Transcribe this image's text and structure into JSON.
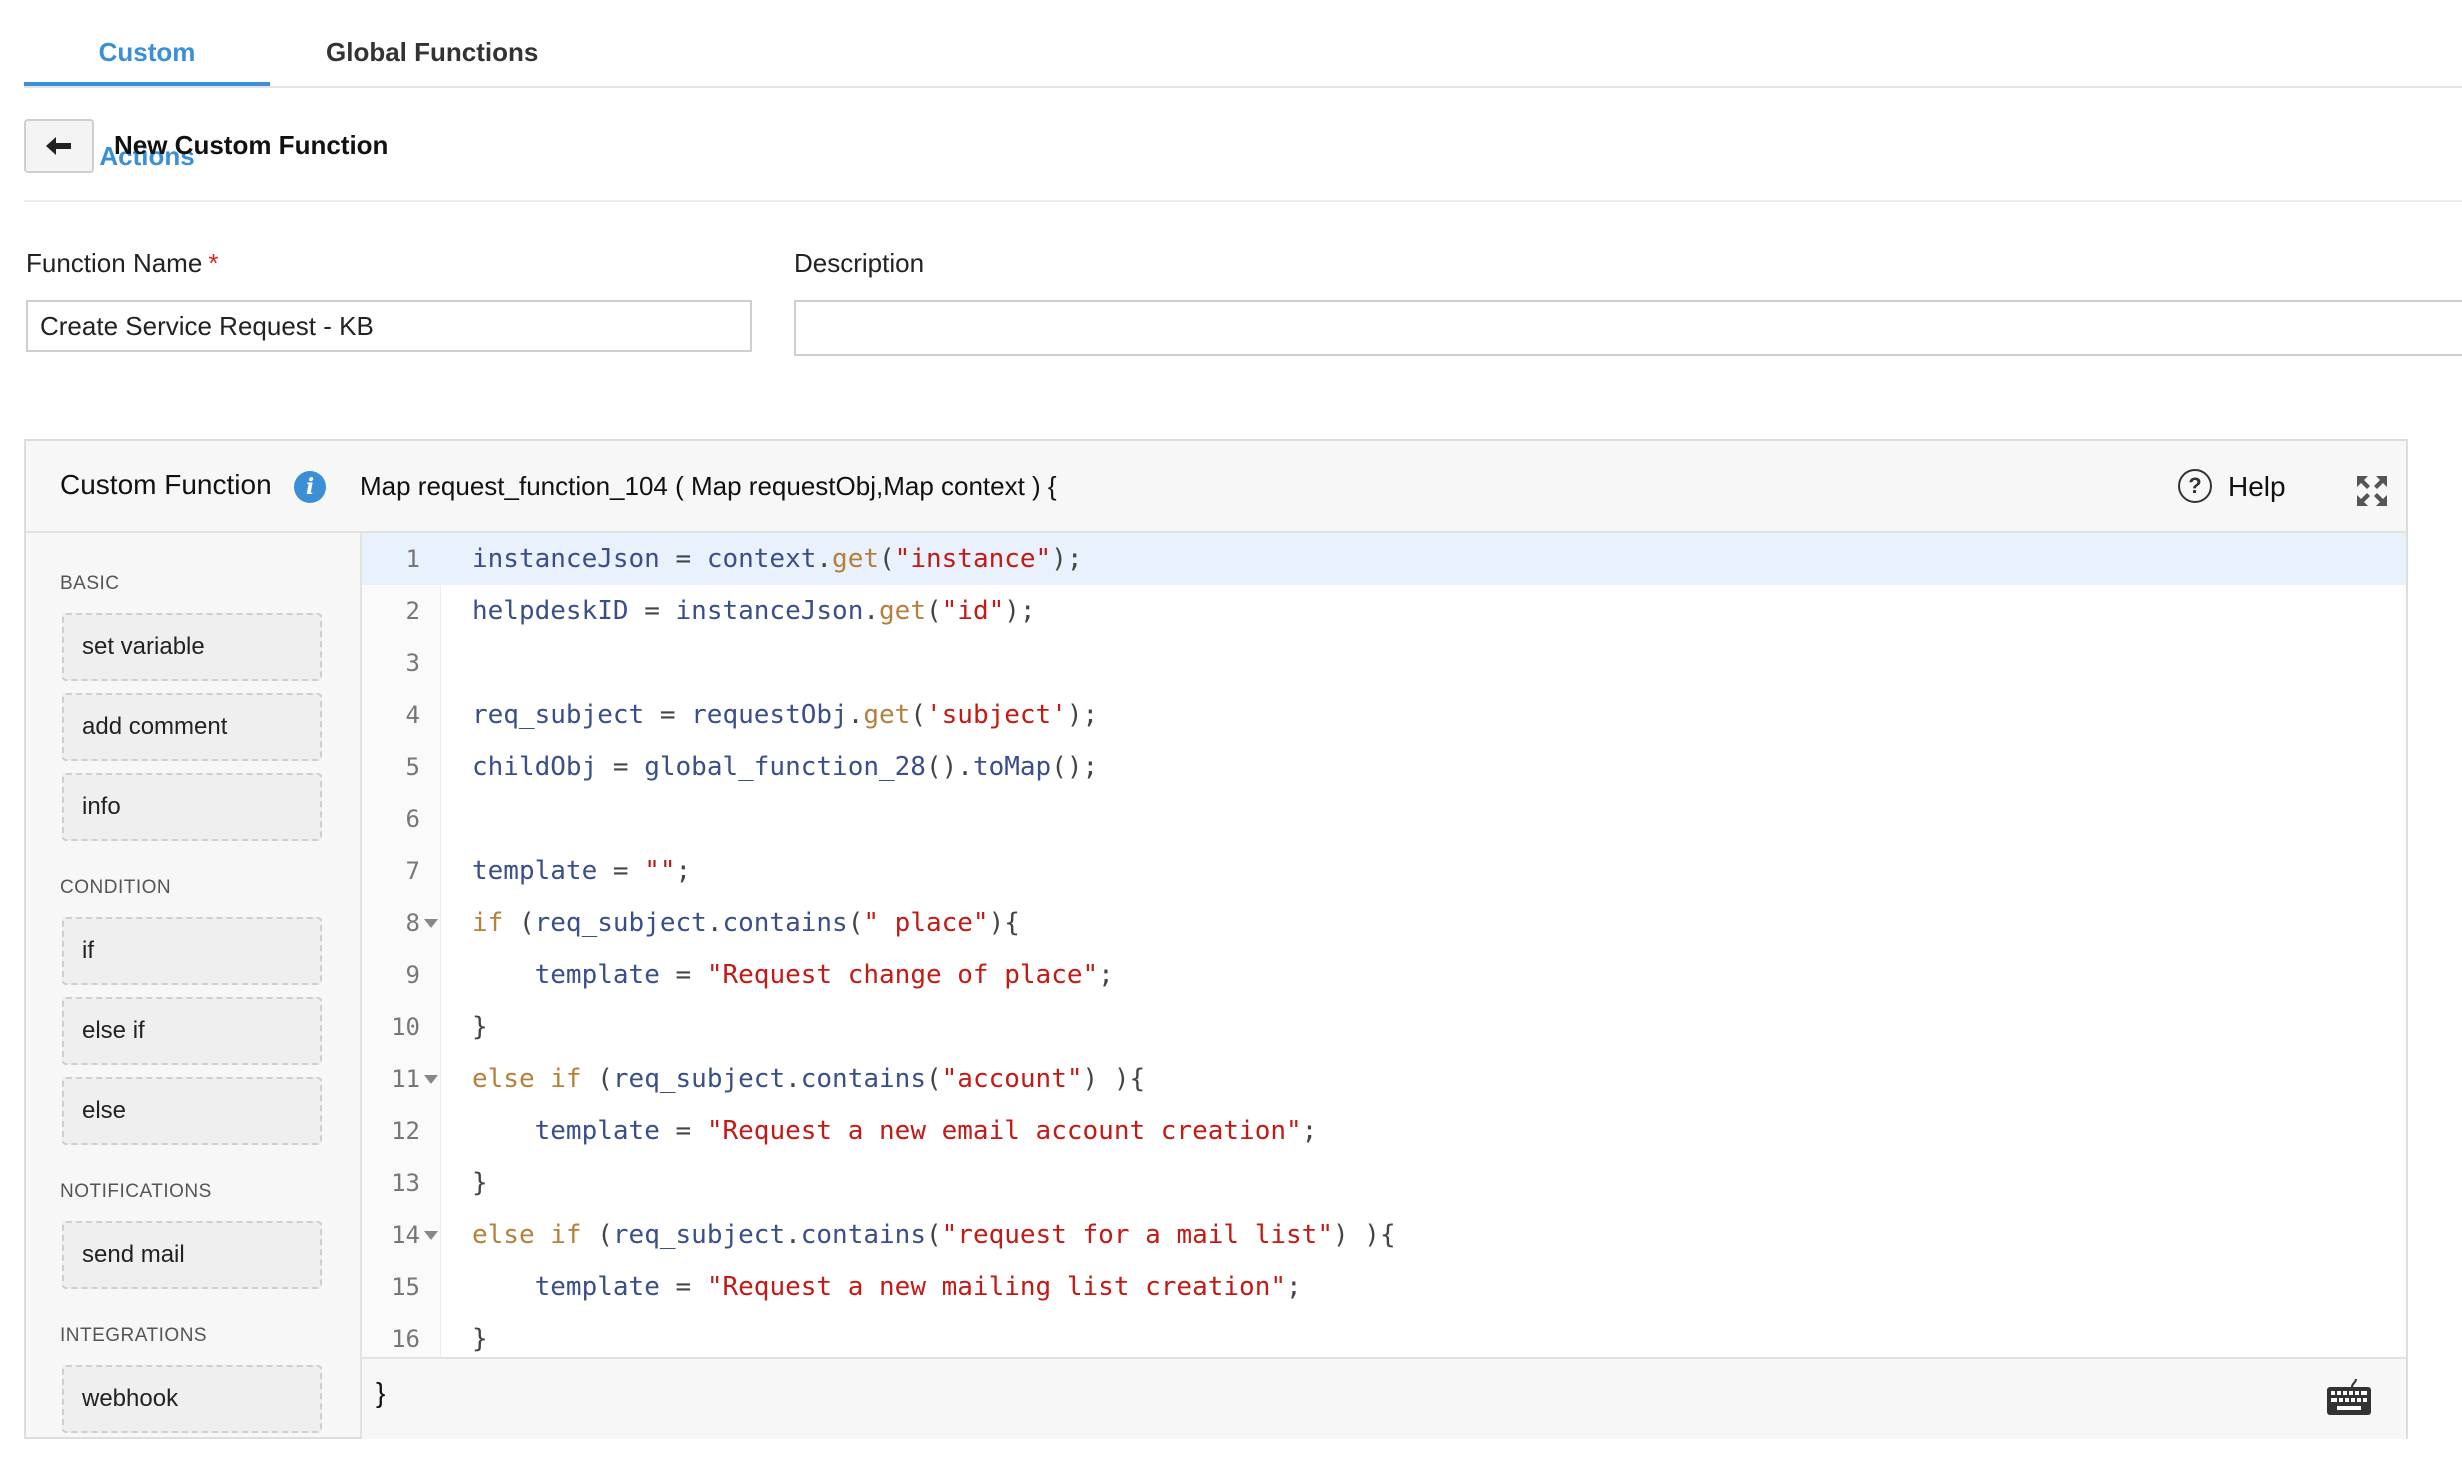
{
  "tabs": [
    {
      "label": "Custom Actions",
      "active": true
    },
    {
      "label": "Global Functions",
      "active": false
    }
  ],
  "header": {
    "back_icon": "arrow-left-icon",
    "title": "New Custom Function"
  },
  "form": {
    "function_name_label": "Function Name",
    "required_marker": "*",
    "function_name_value": "Create Service Request - KB",
    "description_label": "Description",
    "description_value": ""
  },
  "editor": {
    "title": "Custom Function",
    "info_icon": "info-icon",
    "signature": "Map request_function_104 ( Map requestObj,Map context ) {",
    "help_label": "Help",
    "help_icon": "question-circle-icon",
    "expand_icon": "expand-icon",
    "closing_brace": "}",
    "keyboard_icon": "keyboard-icon"
  },
  "sidebar": {
    "sections": [
      {
        "title": "BASIC",
        "items": [
          "set variable",
          "add comment",
          "info"
        ]
      },
      {
        "title": "CONDITION",
        "items": [
          "if",
          "else if",
          "else"
        ]
      },
      {
        "title": "NOTIFICATIONS",
        "items": [
          "send mail"
        ]
      },
      {
        "title": "INTEGRATIONS",
        "items": [
          "webhook"
        ]
      }
    ]
  },
  "code_lines": [
    {
      "n": "1",
      "text": "instanceJson = context.get(\"instance\");",
      "highlighted": true
    },
    {
      "n": "2",
      "text": "helpdeskID = instanceJson.get(\"id\");"
    },
    {
      "n": "3",
      "text": ""
    },
    {
      "n": "4",
      "text": "req_subject = requestObj.get('subject');"
    },
    {
      "n": "5",
      "text": "childObj = global_function_28().toMap();"
    },
    {
      "n": "6",
      "text": ""
    },
    {
      "n": "7",
      "text": "template = \"\";"
    },
    {
      "n": "8",
      "text": "if (req_subject.contains(\" place\"){",
      "fold": true
    },
    {
      "n": "9",
      "text": "    template = \"Request change of place\";"
    },
    {
      "n": "10",
      "text": "}"
    },
    {
      "n": "11",
      "text": "else if (req_subject.contains(\"account\") ){",
      "fold": true
    },
    {
      "n": "12",
      "text": "    template = \"Request a new email account creation\";"
    },
    {
      "n": "13",
      "text": "}"
    },
    {
      "n": "14",
      "text": "else if (req_subject.contains(\"request for a mail list\") ){",
      "fold": true
    },
    {
      "n": "15",
      "text": "    template = \"Request a new mailing list creation\";"
    },
    {
      "n": "16",
      "text": "}"
    }
  ]
}
